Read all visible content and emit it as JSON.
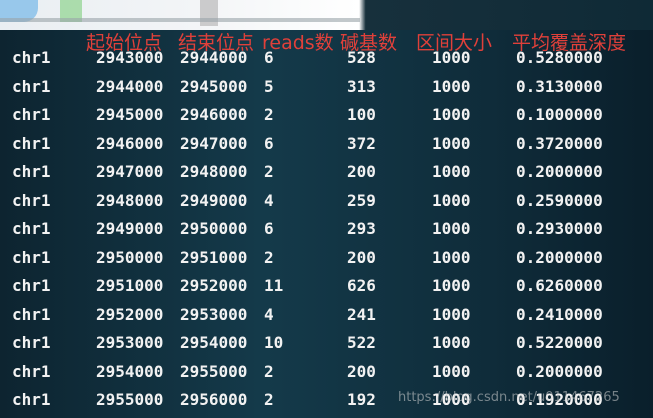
{
  "headers": [
    "起始位点",
    "结束位点",
    "reads数",
    "碱基数",
    "区间大小",
    "平均覆盖深度"
  ],
  "rows": [
    [
      "chr1",
      "2943000",
      "2944000",
      "6",
      "528",
      "1000",
      "0.5280000"
    ],
    [
      "chr1",
      "2944000",
      "2945000",
      "5",
      "313",
      "1000",
      "0.3130000"
    ],
    [
      "chr1",
      "2945000",
      "2946000",
      "2",
      "100",
      "1000",
      "0.1000000"
    ],
    [
      "chr1",
      "2946000",
      "2947000",
      "6",
      "372",
      "1000",
      "0.3720000"
    ],
    [
      "chr1",
      "2947000",
      "2948000",
      "2",
      "200",
      "1000",
      "0.2000000"
    ],
    [
      "chr1",
      "2948000",
      "2949000",
      "4",
      "259",
      "1000",
      "0.2590000"
    ],
    [
      "chr1",
      "2949000",
      "2950000",
      "6",
      "293",
      "1000",
      "0.2930000"
    ],
    [
      "chr1",
      "2950000",
      "2951000",
      "2",
      "200",
      "1000",
      "0.2000000"
    ],
    [
      "chr1",
      "2951000",
      "2952000",
      "11",
      "626",
      "1000",
      "0.6260000"
    ],
    [
      "chr1",
      "2952000",
      "2953000",
      "4",
      "241",
      "1000",
      "0.2410000"
    ],
    [
      "chr1",
      "2953000",
      "2954000",
      "10",
      "522",
      "1000",
      "0.5220000"
    ],
    [
      "chr1",
      "2954000",
      "2955000",
      "2",
      "200",
      "1000",
      "0.2000000"
    ],
    [
      "chr1",
      "2955000",
      "2956000",
      "2",
      "192",
      "1000",
      "0.1920000"
    ]
  ],
  "watermark": "https://blog.csdn.net/u011467265",
  "colors": {
    "header_text": "#e0403a",
    "cell_text": "#f2f2f2",
    "background": "#123444"
  }
}
